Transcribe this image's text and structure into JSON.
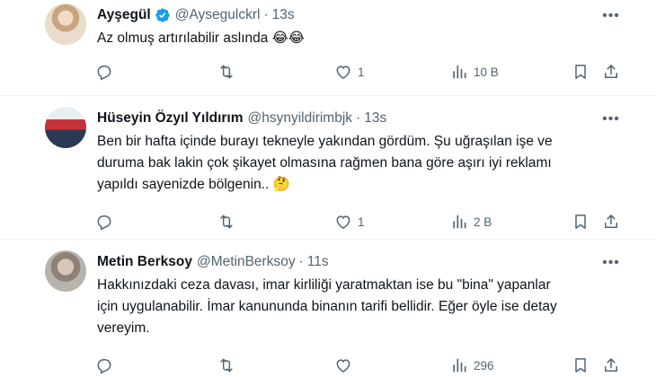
{
  "tweets": [
    {
      "name": "Ayşegül",
      "verified": true,
      "handle": "@Aysegulckrl",
      "time": "13s",
      "text": "Az olmuş artırılabilir aslında 😂😂",
      "reply_count": "",
      "retweet_count": "",
      "like_count": "1",
      "view_count": "10 B"
    },
    {
      "name": "Hüseyin Özyıl Yıldırım",
      "verified": false,
      "handle": "@hsynyildirimbjk",
      "time": "13s",
      "text": "Ben bir hafta içinde burayı tekneyle yakından gördüm. Şu uğraşılan işe ve\nduruma bak lakin çok şikayet olmasına rağmen bana göre aşırı iyi reklamı\nyapıldı sayenizde bölgenin.. 🤔",
      "reply_count": "",
      "retweet_count": "",
      "like_count": "1",
      "view_count": "2 B"
    },
    {
      "name": "Metin Berksoy",
      "verified": false,
      "handle": "@MetinBerksoy",
      "time": "11s",
      "text": "Hakkınızdaki ceza davası, imar kirliliği yaratmaktan ise bu \"bina\" yapanlar\niçin uygulanabilir. İmar kanununda binanın tarifi bellidir. Eğer öyle ise detay\nvereyim.",
      "reply_count": "",
      "retweet_count": "",
      "like_count": "",
      "view_count": "296"
    }
  ],
  "separator": "·",
  "colors": {
    "verified": "#1d9bf0",
    "muted": "#536471",
    "text": "#0f1419",
    "divider": "#eff3f4"
  },
  "icons": [
    "reply-icon",
    "retweet-icon",
    "like-icon",
    "views-icon",
    "bookmark-icon",
    "share-icon",
    "more-icon",
    "verified-badge-icon"
  ]
}
